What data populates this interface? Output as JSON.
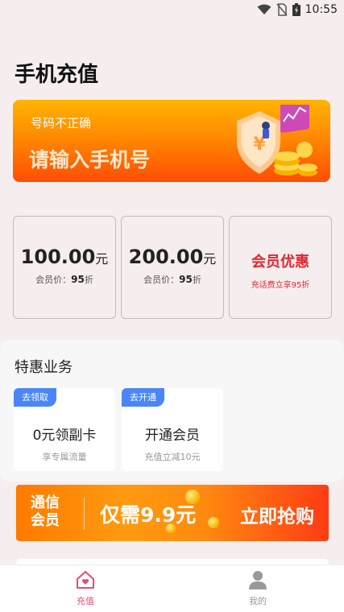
{
  "status": {
    "time": "10:55"
  },
  "header": {
    "title": "手机充值"
  },
  "phone_card": {
    "error": "号码不正确",
    "placeholder": "请输入手机号"
  },
  "packages": [
    {
      "amount": "100.00",
      "unit": "元",
      "price_label": "会员价：",
      "discount": "95",
      "discount_unit": "折"
    },
    {
      "amount": "200.00",
      "unit": "元",
      "price_label": "会员价：",
      "discount": "95",
      "discount_unit": "折"
    }
  ],
  "vip": {
    "title": "会员优惠",
    "subtitle": "充话费立享95折"
  },
  "special": {
    "title": "特惠业务",
    "items": [
      {
        "tag": "去领取",
        "name": "0元领副卡",
        "sub": "享专属流量"
      },
      {
        "tag": "去开通",
        "name": "开通会员",
        "sub": "充值立减10元"
      }
    ]
  },
  "banner": {
    "left_line1": "通信",
    "left_line2": "会员",
    "price": "仅需9.9元",
    "cta": "立即抢购"
  },
  "tabs": [
    {
      "label": "充值",
      "icon": "home-heart-icon",
      "active": true,
      "color": "#e0506f"
    },
    {
      "label": "我的",
      "icon": "person-icon",
      "active": false,
      "color": "#999999"
    }
  ],
  "colors": {
    "accent_orange": "#ff8a00",
    "vip_red": "#e52631",
    "tag_blue": "#4a86f7"
  }
}
